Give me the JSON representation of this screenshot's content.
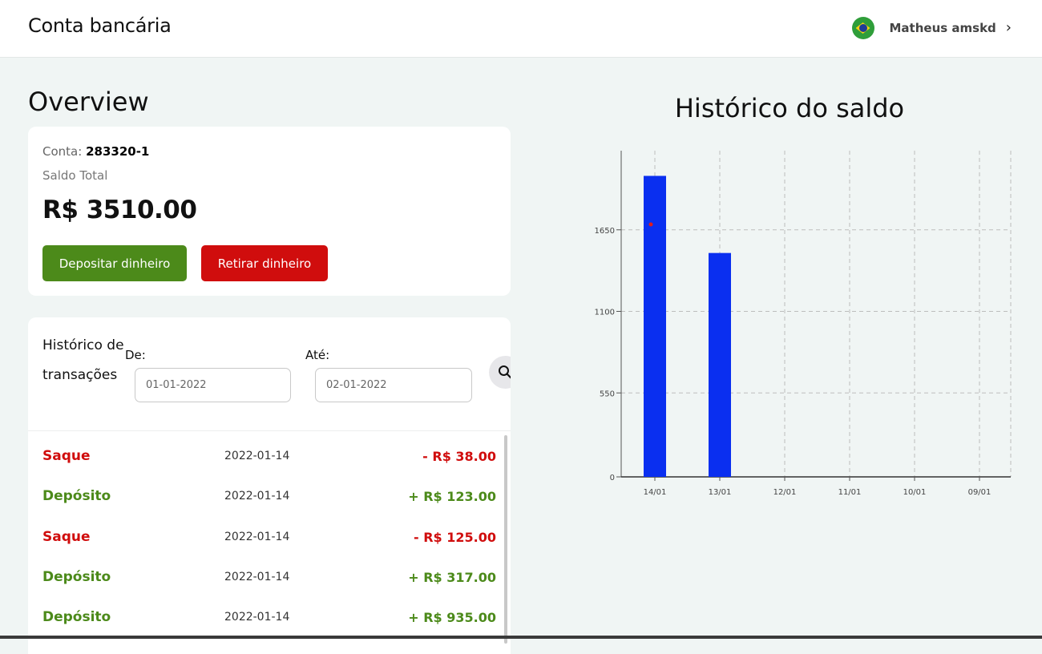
{
  "header": {
    "app_title": "Conta bancária",
    "user_name": "Matheus amskd",
    "flag_icon": "brazil-flag-icon",
    "user_menu_icon": "chevron-right-icon"
  },
  "overview": {
    "title": "Overview",
    "account_label": "Conta:",
    "account_number": "283320-1",
    "balance_label": "Saldo Total",
    "balance_value": "R$ 3510.00",
    "deposit_button": "Depositar dinheiro",
    "withdraw_button": "Retirar dinheiro"
  },
  "transactions": {
    "title": "Histórico de transações",
    "from_label": "De:",
    "to_label": "Até:",
    "from_value": "01-01-2022",
    "to_value": "02-01-2022",
    "search_icon": "search-icon",
    "rows": [
      {
        "type": "Saque",
        "date": "2022-01-14",
        "amount": "- R$ 38.00",
        "kind": "neg"
      },
      {
        "type": "Depósito",
        "date": "2022-01-14",
        "amount": "+ R$ 123.00",
        "kind": "pos"
      },
      {
        "type": "Saque",
        "date": "2022-01-14",
        "amount": "- R$ 125.00",
        "kind": "neg"
      },
      {
        "type": "Depósito",
        "date": "2022-01-14",
        "amount": "+ R$ 317.00",
        "kind": "pos"
      },
      {
        "type": "Depósito",
        "date": "2022-01-14",
        "amount": "+ R$ 935.00",
        "kind": "pos"
      }
    ]
  },
  "colors": {
    "deposit": "#4c8a1a",
    "withdraw": "#d00d0d",
    "bar": "#0a2ff0"
  },
  "chart_data": {
    "type": "bar",
    "title": "Histórico do saldo",
    "categories": [
      "14/01",
      "13/01",
      "12/01",
      "11/01",
      "10/01",
      "09/01"
    ],
    "values": [
      2030,
      1510,
      0,
      0,
      0,
      0
    ],
    "ylim": [
      0,
      2200
    ],
    "yticks": [
      0,
      550,
      1100,
      1650,
      2200
    ],
    "grid": true,
    "color": "#0a2ff0"
  }
}
